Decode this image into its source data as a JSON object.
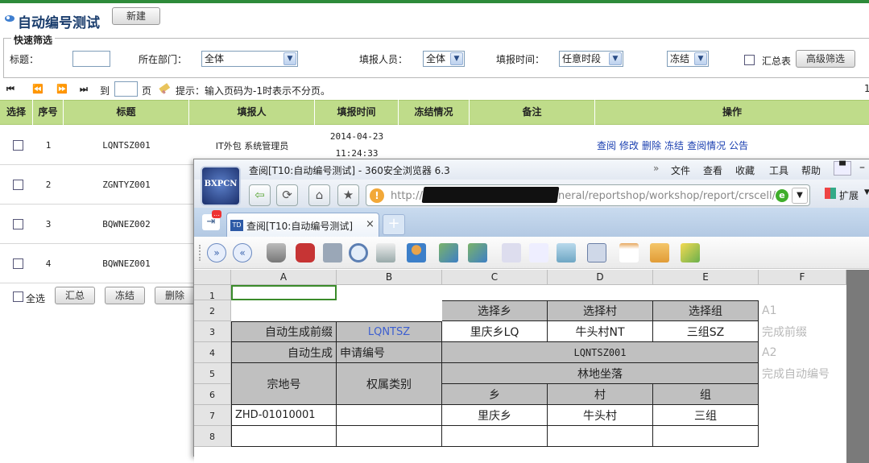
{
  "page": {
    "title": "自动编号测试",
    "new_button": "新建"
  },
  "filter": {
    "legend": "快速筛选",
    "title_label": "标题：",
    "title_value": "",
    "dept_label": "所在部门：",
    "dept_value": "全体",
    "filler_label": "填报人员：",
    "filler_value": "全体",
    "time_label": "填报时间：",
    "time_value": "任意时段",
    "freeze_value": "冻结",
    "summary_label": "汇总表",
    "advanced_button": "高级筛选"
  },
  "pager": {
    "to_label": "到",
    "page_label": "页",
    "hint": "提示：输入页码为-1时表示不分页。",
    "right_num": "1"
  },
  "table": {
    "headers": [
      "选择",
      "序号",
      "标题",
      "填报人",
      "填报时间",
      "冻结情况",
      "备注",
      "操作"
    ],
    "rows": [
      {
        "no": "1",
        "title": "LQNTSZ001",
        "filler": "IT外包 系统管理员",
        "date": "2014-04-23",
        "time": "11:24:33",
        "actions": [
          "查阅",
          "修改",
          "删除",
          "冻结",
          "查阅情况",
          "公告"
        ]
      },
      {
        "no": "2",
        "title": "ZGNTYZ001"
      },
      {
        "no": "3",
        "title": "BQWNEZ002"
      },
      {
        "no": "4",
        "title": "BQWNEZ001"
      }
    ],
    "footer": {
      "select_all": "全选",
      "summary": "汇总",
      "freeze": "冻结",
      "delete": "删除"
    }
  },
  "browser": {
    "window_title": "查阅[T10:自动编号测试] - 360安全浏览器 6.3",
    "menu": [
      "文件",
      "查看",
      "收藏",
      "工具",
      "帮助"
    ],
    "logo_text": "BXPCN",
    "url_visible": "neral/reportshop/workshop/report/crscell/cr",
    "url_prefix": "http://",
    "ext_label": "扩展",
    "tab_label": "查阅[T10:自动编号测试]",
    "tab_badge": "TD"
  },
  "sheet": {
    "columns": [
      "A",
      "B",
      "C",
      "D",
      "E",
      "F"
    ],
    "rows": [
      "1",
      "2",
      "3",
      "4",
      "5",
      "6",
      "7",
      "8"
    ],
    "cells": {
      "c2": "选择乡",
      "d2": "选择村",
      "e2": "选择组",
      "f2": "A1",
      "a3": "自动生成前缀",
      "b3": "LQNTSZ",
      "c3": "里庆乡LQ",
      "d3": "牛头村NT",
      "e3": "三组SZ",
      "f3": "完成前缀",
      "a4": "自动生成",
      "b4": "申请编号",
      "cde4": "LQNTSZ001",
      "f4": "A2",
      "a56": "宗地号",
      "b56": "权属类别",
      "cde5": "林地坐落",
      "f5": "完成自动编号",
      "c6": "乡",
      "d6": "村",
      "e6": "组",
      "a7": "ZHD-01010001",
      "c7": "里庆乡",
      "d7": "牛头村",
      "e7": "三组"
    }
  }
}
